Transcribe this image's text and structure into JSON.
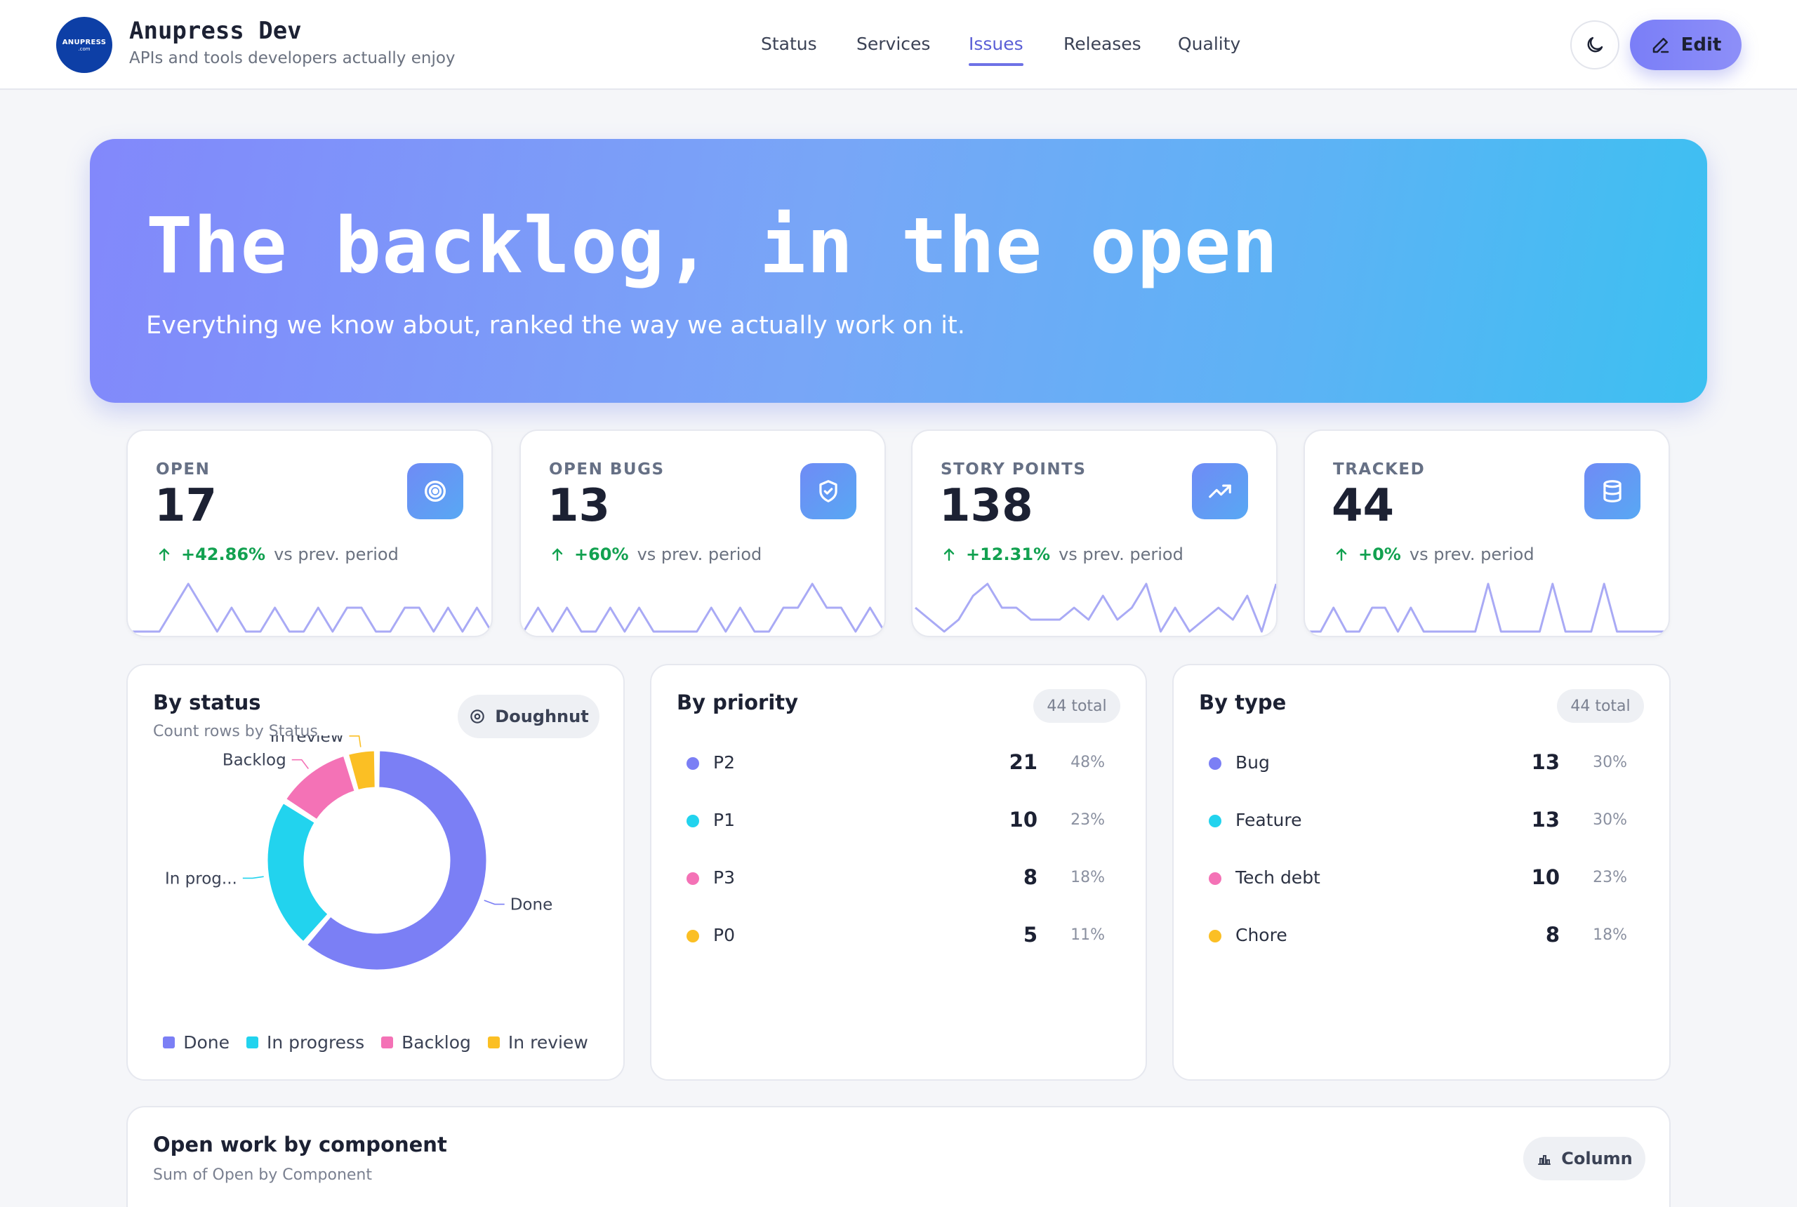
{
  "app": {
    "logo_text": "ANUPRESS",
    "logo_subtext": ".com",
    "name": "Anupress Dev",
    "tagline": "APIs and tools developers actually enjoy"
  },
  "nav": [
    {
      "label": "Status",
      "active": false
    },
    {
      "label": "Services",
      "active": false
    },
    {
      "label": "Issues",
      "active": true
    },
    {
      "label": "Releases",
      "active": false
    },
    {
      "label": "Quality",
      "active": false
    }
  ],
  "header_actions": {
    "theme_icon": "moon-icon",
    "edit_icon": "pencil-icon",
    "edit_label": "Edit"
  },
  "hero": {
    "title": "The backlog, in the open",
    "subtitle": "Everything we know about, ranked the way we actually work on it."
  },
  "kpis": [
    {
      "label": "OPEN",
      "value": "17",
      "delta": "+42.86%",
      "delta_suffix": "vs prev. period",
      "icon": "target-icon"
    },
    {
      "label": "OPEN BUGS",
      "value": "13",
      "delta": "+60%",
      "delta_suffix": "vs prev. period",
      "icon": "shield-check-icon"
    },
    {
      "label": "STORY POINTS",
      "value": "138",
      "delta": "+12.31%",
      "delta_suffix": "vs prev. period",
      "icon": "trending-up-icon"
    },
    {
      "label": "TRACKED",
      "value": "44",
      "delta": "+0%",
      "delta_suffix": "vs prev. period",
      "icon": "database-icon"
    }
  ],
  "sparklines": [
    [
      0,
      0,
      0,
      1,
      2,
      1,
      0,
      1,
      0,
      0,
      1,
      0,
      0,
      1,
      0,
      1,
      1,
      0,
      0,
      1,
      1,
      0,
      1,
      0,
      1,
      0
    ],
    [
      0,
      1,
      0,
      1,
      0,
      0,
      1,
      0,
      1,
      0,
      0,
      0,
      0,
      1,
      0,
      1,
      0,
      0,
      1,
      1,
      2,
      1,
      1,
      0,
      1,
      0
    ],
    [
      1,
      0.5,
      0,
      0.5,
      1.5,
      2,
      1,
      1,
      0.5,
      0.5,
      0.5,
      1,
      0.5,
      1.5,
      0.5,
      1,
      2,
      0,
      1,
      0,
      0.5,
      1,
      0.5,
      1.5,
      0,
      2
    ],
    [
      0,
      0,
      1,
      0,
      0,
      1,
      1,
      0,
      1,
      0,
      0,
      0,
      0,
      0,
      2,
      0,
      0,
      0,
      0,
      2,
      0,
      0,
      0,
      2,
      0,
      0,
      0,
      0,
      0
    ]
  ],
  "by_status": {
    "title": "By status",
    "subtitle": "Count rows by Status",
    "button_label": "Doughnut",
    "button_icon": "donut-icon"
  },
  "by_priority": {
    "title": "By priority",
    "total_label": "44 total",
    "rows": [
      {
        "label": "P2",
        "count": "21",
        "pct": "48%",
        "color": "#7b7ff5"
      },
      {
        "label": "P1",
        "count": "10",
        "pct": "23%",
        "color": "#22d3ee"
      },
      {
        "label": "P3",
        "count": "8",
        "pct": "18%",
        "color": "#f472b6"
      },
      {
        "label": "P0",
        "count": "5",
        "pct": "11%",
        "color": "#fbbf24"
      }
    ]
  },
  "by_type": {
    "title": "By type",
    "total_label": "44 total",
    "rows": [
      {
        "label": "Bug",
        "count": "13",
        "pct": "30%",
        "color": "#7b7ff5"
      },
      {
        "label": "Feature",
        "count": "13",
        "pct": "30%",
        "color": "#22d3ee"
      },
      {
        "label": "Tech debt",
        "count": "10",
        "pct": "23%",
        "color": "#f472b6"
      },
      {
        "label": "Chore",
        "count": "8",
        "pct": "18%",
        "color": "#fbbf24"
      }
    ]
  },
  "open_work": {
    "title": "Open work by component",
    "subtitle": "Sum of Open by Component",
    "button_label": "Column",
    "button_icon": "bar-chart-icon"
  },
  "chart_data": {
    "type": "pie",
    "categories": [
      "Done",
      "In progress",
      "Backlog",
      "In review"
    ],
    "values": [
      27,
      10,
      5,
      2
    ],
    "slice_labels": [
      "Done",
      "In prog...",
      "Backlog",
      "In review"
    ],
    "colors": [
      "#7b7ff5",
      "#22d3ee",
      "#f472b6",
      "#fbbf24"
    ],
    "legend": "bottom"
  },
  "colors": {
    "accent": "#6e72e6",
    "positive": "#12a150",
    "spark_line": "#a9aaf5"
  }
}
